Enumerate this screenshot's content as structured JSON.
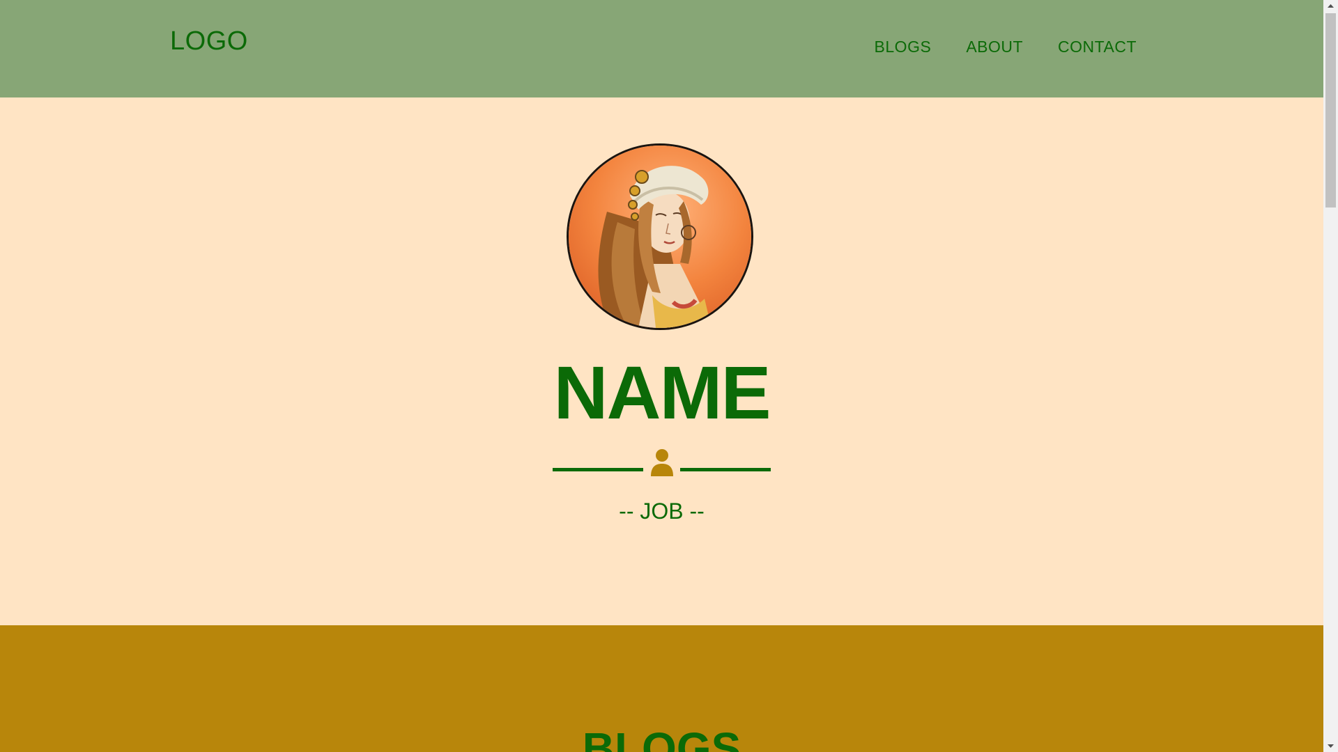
{
  "navbar": {
    "logo": "LOGO",
    "links": [
      {
        "label": "BLOGS"
      },
      {
        "label": "ABOUT"
      },
      {
        "label": "CONTACT"
      }
    ]
  },
  "hero": {
    "avatar_icon": "portrait-illustration",
    "name": "NAME",
    "divider_icon": "user-icon",
    "job": "-- JOB --"
  },
  "blogs": {
    "title": "BLOGS"
  },
  "colors": {
    "navbar_bg": "#87A676",
    "hero_bg": "#FFE4C4",
    "text_green": "#0B6A07",
    "accent_gold": "#B8860B"
  }
}
